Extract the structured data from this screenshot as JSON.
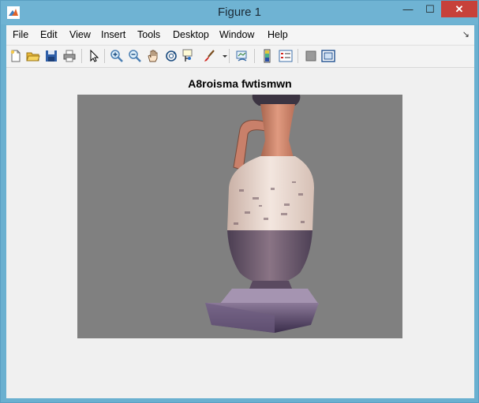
{
  "window": {
    "title": "Figure 1",
    "minimize_label": "—",
    "maximize_label": "☐",
    "close_label": "✕"
  },
  "menu": {
    "items": [
      {
        "label": "File"
      },
      {
        "label": "Edit"
      },
      {
        "label": "View"
      },
      {
        "label": "Insert"
      },
      {
        "label": "Tools"
      },
      {
        "label": "Desktop"
      },
      {
        "label": "Window"
      },
      {
        "label": "Help"
      }
    ],
    "dock_glyph": "↘"
  },
  "toolbar": {
    "buttons": [
      "new-figure-icon",
      "open-file-icon",
      "save-icon",
      "print-icon",
      "edit-plot-arrow-icon",
      "zoom-in-icon",
      "zoom-out-icon",
      "pan-hand-icon",
      "rotate-3d-icon",
      "data-cursor-icon",
      "brush-icon",
      "brush-dropdown-icon",
      "link-plot-icon",
      "insert-colorbar-icon",
      "insert-legend-icon",
      "hide-plot-tools-icon",
      "show-plot-tools-icon"
    ]
  },
  "axes": {
    "title": "A8roisma fwtismwn",
    "background": "#808080",
    "image_subject": "amphora-vase-icon"
  }
}
